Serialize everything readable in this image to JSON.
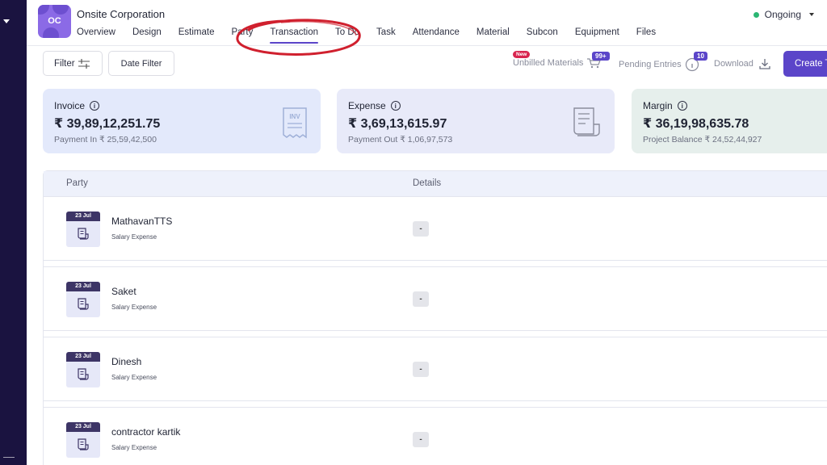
{
  "header": {
    "logo_initials": "OC",
    "company_name": "Onsite Corporation",
    "status": "Ongoing",
    "status_color": "#2bb673",
    "tabs": [
      {
        "label": "Overview"
      },
      {
        "label": "Design"
      },
      {
        "label": "Estimate"
      },
      {
        "label": "Party"
      },
      {
        "label": "Transaction"
      },
      {
        "label": "To Do"
      },
      {
        "label": "Task"
      },
      {
        "label": "Attendance"
      },
      {
        "label": "Material"
      },
      {
        "label": "Subcon"
      },
      {
        "label": "Equipment"
      },
      {
        "label": "Files"
      }
    ],
    "active_tab": "Transaction"
  },
  "toolbar": {
    "filter_label": "Filter",
    "date_filter_label": "Date Filter",
    "unbilled_label": "Unbilled Materials",
    "unbilled_new_badge": "New",
    "unbilled_count": "99+",
    "pending_label": "Pending Entries",
    "pending_count": "10",
    "download_label": "Download",
    "create_label": "Create T"
  },
  "cards": [
    {
      "label": "Invoice",
      "amount": "₹ 39,89,12,251.75",
      "sub": "Payment In ₹ 25,59,42,500",
      "icon": "invoice-icon",
      "icon_text": "INV",
      "bg": "#e3e9fb"
    },
    {
      "label": "Expense",
      "amount": "₹ 3,69,13,615.97",
      "sub": "Payment Out ₹ 1,06,97,573",
      "icon": "receipt-icon",
      "bg": "#e8eaf9"
    },
    {
      "label": "Margin",
      "amount": "₹ 36,19,98,635.78",
      "sub": "Project Balance ₹ 24,52,44,927",
      "icon": "balance-icon",
      "bg": "#e6efec"
    }
  ],
  "table": {
    "col_party": "Party",
    "col_details": "Details",
    "rows": [
      {
        "date": "23 Jul",
        "name": "MathavanTTS",
        "type": "Salary Expense",
        "details": "-"
      },
      {
        "date": "23 Jul",
        "name": "Saket",
        "type": "Salary Expense",
        "details": "-"
      },
      {
        "date": "23 Jul",
        "name": "Dinesh",
        "type": "Salary Expense",
        "details": "-"
      },
      {
        "date": "23 Jul",
        "name": "contractor kartik",
        "type": "Salary Expense",
        "details": "-"
      }
    ]
  },
  "colors": {
    "accent": "#5b45c9",
    "sidebar": "#1a1340",
    "annotation": "#d0202e"
  }
}
